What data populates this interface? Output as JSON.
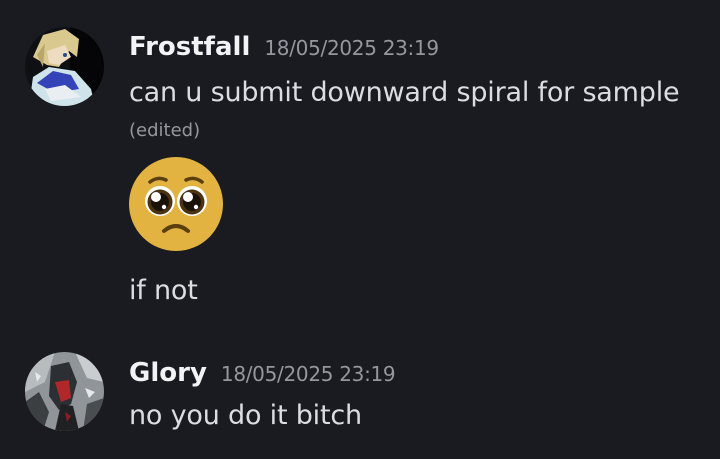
{
  "messages": [
    {
      "author": "Frostfall",
      "timestamp": "18/05/2025 23:19",
      "text": "can u submit downward spiral for sample",
      "edited_label": "(edited)",
      "emoji": "pleading-face",
      "followup_text": "if not"
    },
    {
      "author": "Glory",
      "timestamp": "18/05/2025 23:19",
      "text": "no you do it bitch"
    }
  ],
  "colors": {
    "background": "#1a1b20",
    "username": "#f2f3f5",
    "message_text": "#dbdee1",
    "muted": "#94979e"
  }
}
